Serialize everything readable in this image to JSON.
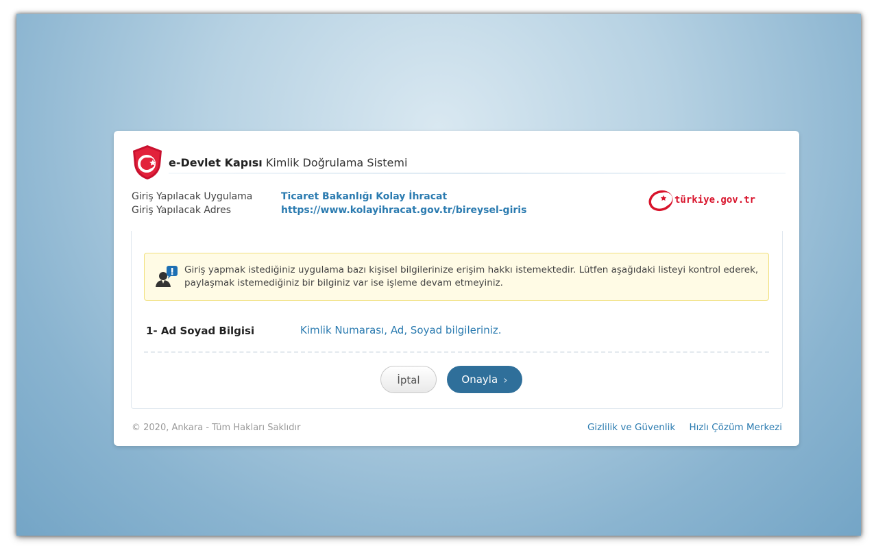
{
  "header": {
    "brand": "e-Devlet Kapısı",
    "subtitle": "Kimlik Doğrulama Sistemi"
  },
  "app_info": {
    "app_label": "Giriş Yapılacak Uygulama",
    "address_label": "Giriş Yapılacak Adres",
    "app_value": "Ticaret Bakanlığı Kolay İhracat",
    "address_value": "https://www.kolayihracat.gov.tr/bireysel-giris"
  },
  "logo_text": "türkiye.gov.tr",
  "alert": {
    "icon": "user-info-icon",
    "line1": "Giriş yapmak istediğiniz uygulama bazı kişisel bilgilerinize erişim hakkı istemektedir. Lütfen aşağıdaki listeyi kontrol ederek,",
    "line2": "paylaşmak istemediğiniz bir bilginiz var ise işleme devam etmeyiniz."
  },
  "permissions": [
    {
      "title": "1- Ad Soyad Bilgisi",
      "description": "Kimlik Numarası, Ad, Soyad bilgileriniz."
    }
  ],
  "buttons": {
    "cancel": "İptal",
    "confirm": "Onayla",
    "confirm_icon": "chevron-right-icon"
  },
  "footer": {
    "copyright": "© 2020, Ankara - Tüm Hakları Saklıdır",
    "privacy_link": "Gizlilik ve Güvenlik",
    "help_link": "Hızlı Çözüm Merkezi"
  },
  "colors": {
    "link_blue": "#2b7bb0",
    "brand_red": "#d8132b",
    "confirm_button": "#2f6f9a",
    "alert_bg": "#fffbe5"
  }
}
